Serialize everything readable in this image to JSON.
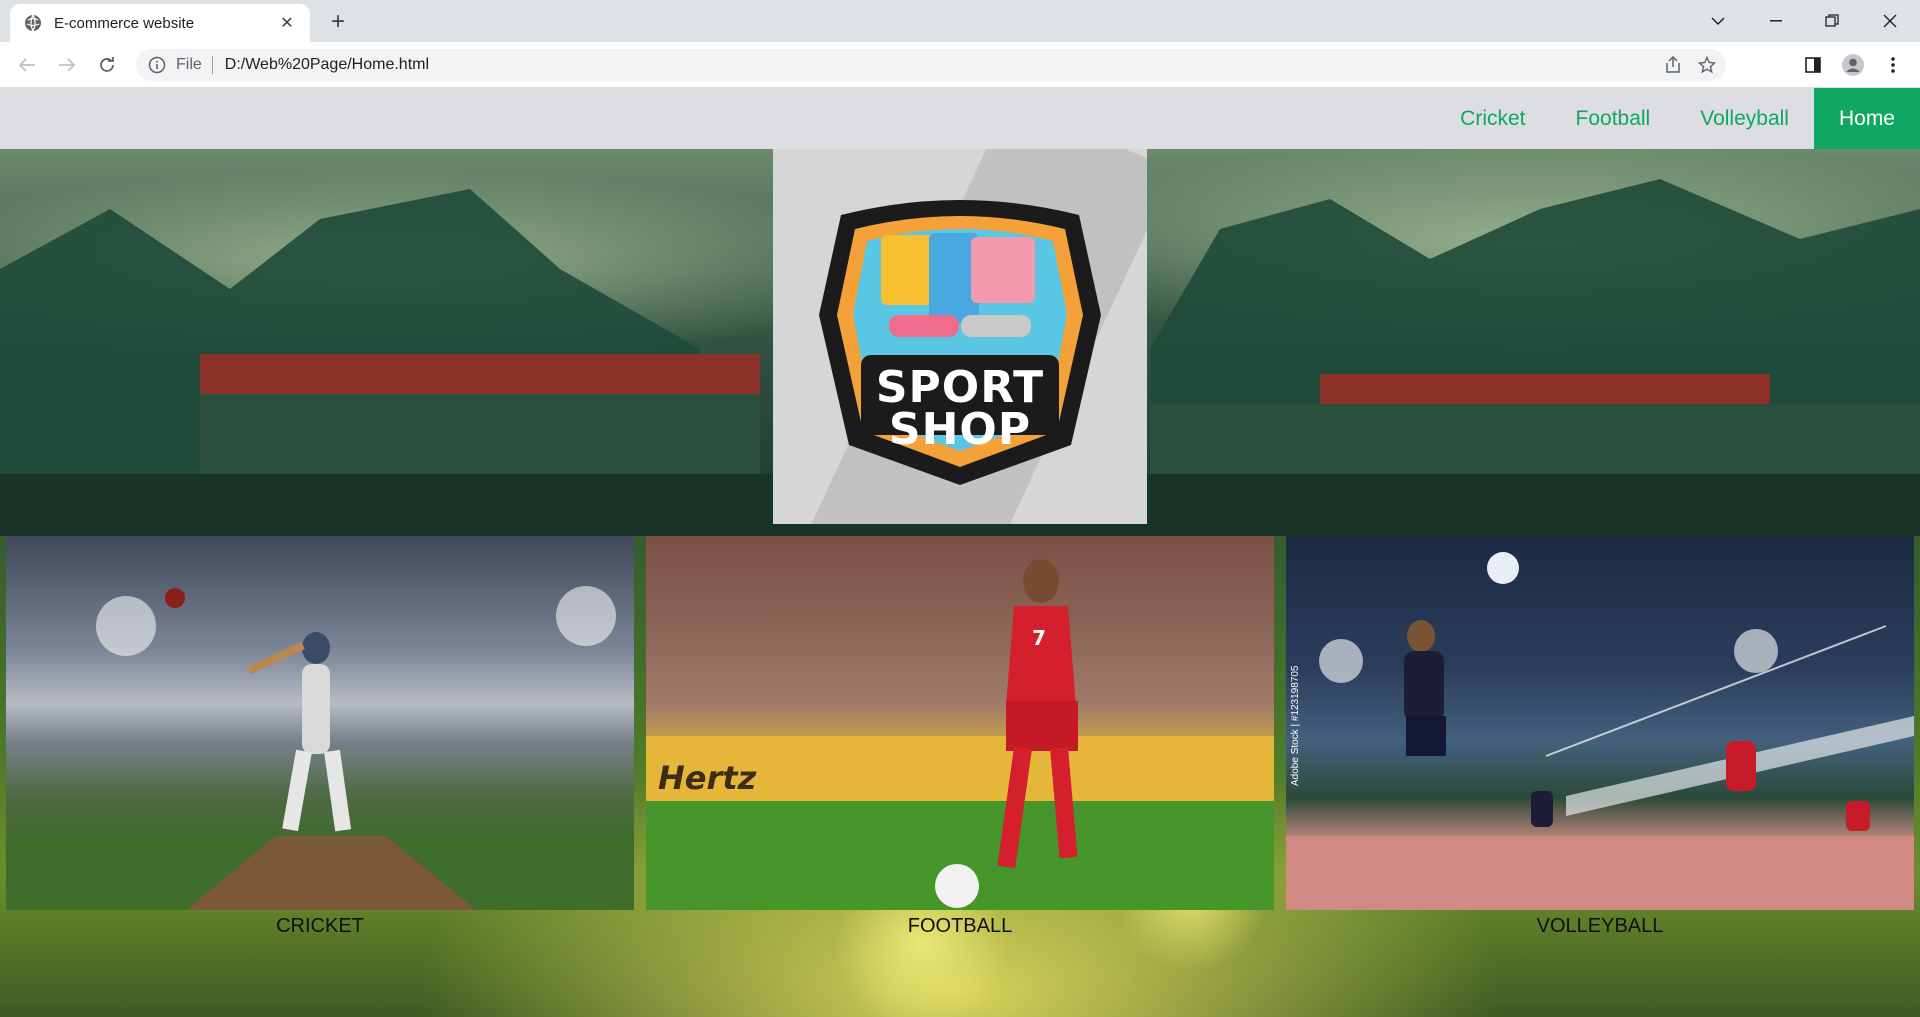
{
  "browser": {
    "tab_title": "E-commerce website",
    "new_tab_label": "+",
    "address_scheme": "File",
    "address_url": "D:/Web%20Page/Home.html"
  },
  "site": {
    "nav": [
      {
        "label": "Cricket",
        "active": false
      },
      {
        "label": "Football",
        "active": false
      },
      {
        "label": "Volleyball",
        "active": false
      },
      {
        "label": "Home",
        "active": true
      }
    ],
    "logo": {
      "line1": "SPORT",
      "line2": "SHOP"
    },
    "categories": [
      {
        "caption": "CRICKET",
        "player_number": ""
      },
      {
        "caption": "FOOTBALL",
        "player_number": "7",
        "banner_text": "Hertz"
      },
      {
        "caption": "VOLLEYBALL",
        "watermark": "Adobe Stock | #123198705"
      }
    ]
  },
  "colors": {
    "accent": "#10a762",
    "navbar_bg": "#dcdee2",
    "chrome_bg": "#dee1e6"
  }
}
